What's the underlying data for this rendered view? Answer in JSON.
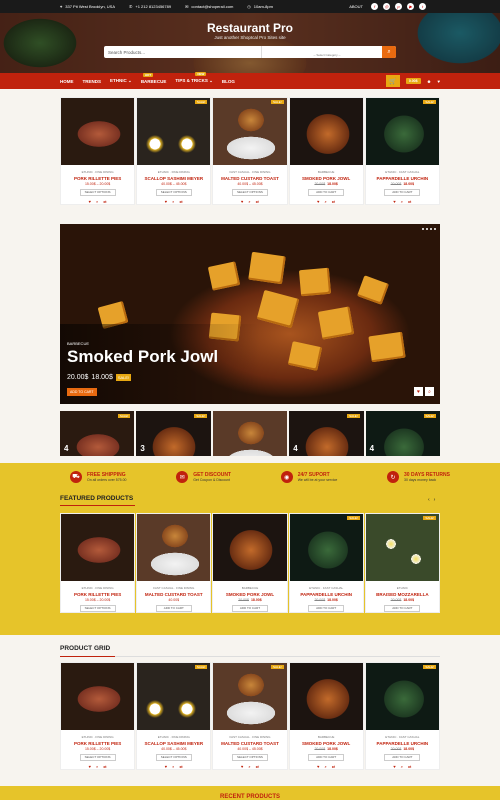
{
  "topbar": {
    "address": "337 Pit West Brooklyn, USA",
    "phone": "+1 212 8123456789",
    "email": "contact@shoperail.com",
    "hours": "10am-8pm",
    "about": "ABOUT"
  },
  "header": {
    "brand": "Restaurant Pro",
    "tagline": "Just another ShopIcal Pro Sites site",
    "search_placeholder": "Search Products...",
    "category_select": "-- Select Category --"
  },
  "nav": {
    "items": [
      "HOME",
      "TRENDS",
      "ETHNIC",
      "BARBECUE",
      "TIPS & TRICKS",
      "BLOG"
    ],
    "badges": {
      "barbecue": "HOT",
      "tips": "NEW"
    },
    "cart_price": "0.00$"
  },
  "top_products": [
    {
      "cat": "ETHNIC · FINE DINING",
      "name": "PORK RILLETTE PIES",
      "price": "15.00$ – 20.00$",
      "btn": "SELECT OPTIONS",
      "sale": ""
    },
    {
      "cat": "ETHNIC · FINE DINING",
      "name": "SCALLOP SASHIMI MEYER",
      "price": "40.00$ – 45.00$",
      "btn": "SELECT OPTIONS",
      "sale": "SALE!"
    },
    {
      "cat": "FAST CASUAL · FINE DINING",
      "name": "MALTED CUSTARD TOAST",
      "price": "40.00$ – 45.00$",
      "btn": "SELECT OPTIONS",
      "sale": "SALE!"
    },
    {
      "cat": "BARBECUE",
      "name": "SMOKED PORK JOWL",
      "price": "18.00$",
      "old": "20.00$",
      "btn": "ADD TO CART",
      "sale": ""
    },
    {
      "cat": "ETHNIC · FAST CASUAL",
      "name": "PAPPARDELLE URCHIN",
      "price": "18.00$",
      "old": "20.00$",
      "btn": "ADD TO CART",
      "sale": "SALE!"
    }
  ],
  "slider": {
    "category": "BARBECUE",
    "title": "Smoked Pork Jowl",
    "price_old": "20.00$",
    "price_new": "18.00$",
    "sale": "SALE!",
    "button": "ADD TO CART"
  },
  "thumbs": [
    {
      "n": "4",
      "sale": "SALE!"
    },
    {
      "n": "3",
      "sale": "SALE!"
    },
    {
      "n": "",
      "sale": ""
    },
    {
      "n": "4",
      "sale": "SALE!"
    },
    {
      "n": "4",
      "sale": "SALE!"
    }
  ],
  "features": [
    {
      "icon": "truck-icon",
      "title": "FREE SHIPPING",
      "sub": "On all orders over 575.00"
    },
    {
      "icon": "discount-icon",
      "title": "GET DISCOUNT",
      "sub": "Get Coupon & Discount"
    },
    {
      "icon": "support-icon",
      "title": "24/7 SUPORT",
      "sub": "We will be at your service"
    },
    {
      "icon": "returns-icon",
      "title": "30 DAYS RETURNS",
      "sub": "30 days money back"
    }
  ],
  "featured": {
    "title": "FEATURED PRODUCTS",
    "items": [
      {
        "cat": "ETHNIC · FINE DINING",
        "name": "PORK RILLETTE PIES",
        "price": "15.00$ – 20.00$",
        "btn": "SELECT OPTIONS",
        "sale": ""
      },
      {
        "cat": "FAST CASUAL · FINE DINING",
        "name": "MALTED CUSTARD TOAST",
        "price": "40.00$",
        "btn": "ADD TO CART",
        "sale": ""
      },
      {
        "cat": "BARBECUE",
        "name": "SMOKED PORK JOWL",
        "price": "18.00$",
        "old": "20.00$",
        "btn": "ADD TO CART",
        "sale": ""
      },
      {
        "cat": "ETHNIC · FAST CASUAL",
        "name": "PAPPARDELLE URCHIN",
        "price": "18.00$",
        "old": "20.00$",
        "btn": "ADD TO CART",
        "sale": "SALE!"
      },
      {
        "cat": "ETHNIC",
        "name": "BRAISED MOZZARELLA",
        "price": "18.00$",
        "old": "20.00$",
        "btn": "ADD TO CART",
        "sale": "SALE!"
      }
    ]
  },
  "grid": {
    "title": "PRODUCT GRID",
    "items": [
      {
        "cat": "ETHNIC · FINE DINING",
        "name": "PORK RILLETTE PIES",
        "price": "15.00$ – 20.00$",
        "btn": "SELECT OPTIONS",
        "sale": ""
      },
      {
        "cat": "ETHNIC · FINE DINING",
        "name": "SCALLOP SASHIMI MEYER",
        "price": "40.00$ – 45.00$",
        "btn": "SELECT OPTIONS",
        "sale": "SALE!"
      },
      {
        "cat": "FAST CASUAL · FINE DINING",
        "name": "MALTED CUSTARD TOAST",
        "price": "40.00$ – 45.00$",
        "btn": "SELECT OPTIONS",
        "sale": "SALE!"
      },
      {
        "cat": "BARBECUE",
        "name": "SMOKED PORK JOWL",
        "price": "18.00$",
        "old": "20.00$",
        "btn": "ADD TO CART",
        "sale": ""
      },
      {
        "cat": "ETHNIC · FAST CASUAL",
        "name": "PAPPARDELLE URCHIN",
        "price": "18.00$",
        "old": "20.00$",
        "btn": "ADD TO CART",
        "sale": "SALE!"
      }
    ]
  },
  "footer_band": "RECENT PRODUCTS",
  "colors": {
    "primary": "#c0220d",
    "accent": "#e86a10",
    "yellow": "#e6c42a"
  }
}
